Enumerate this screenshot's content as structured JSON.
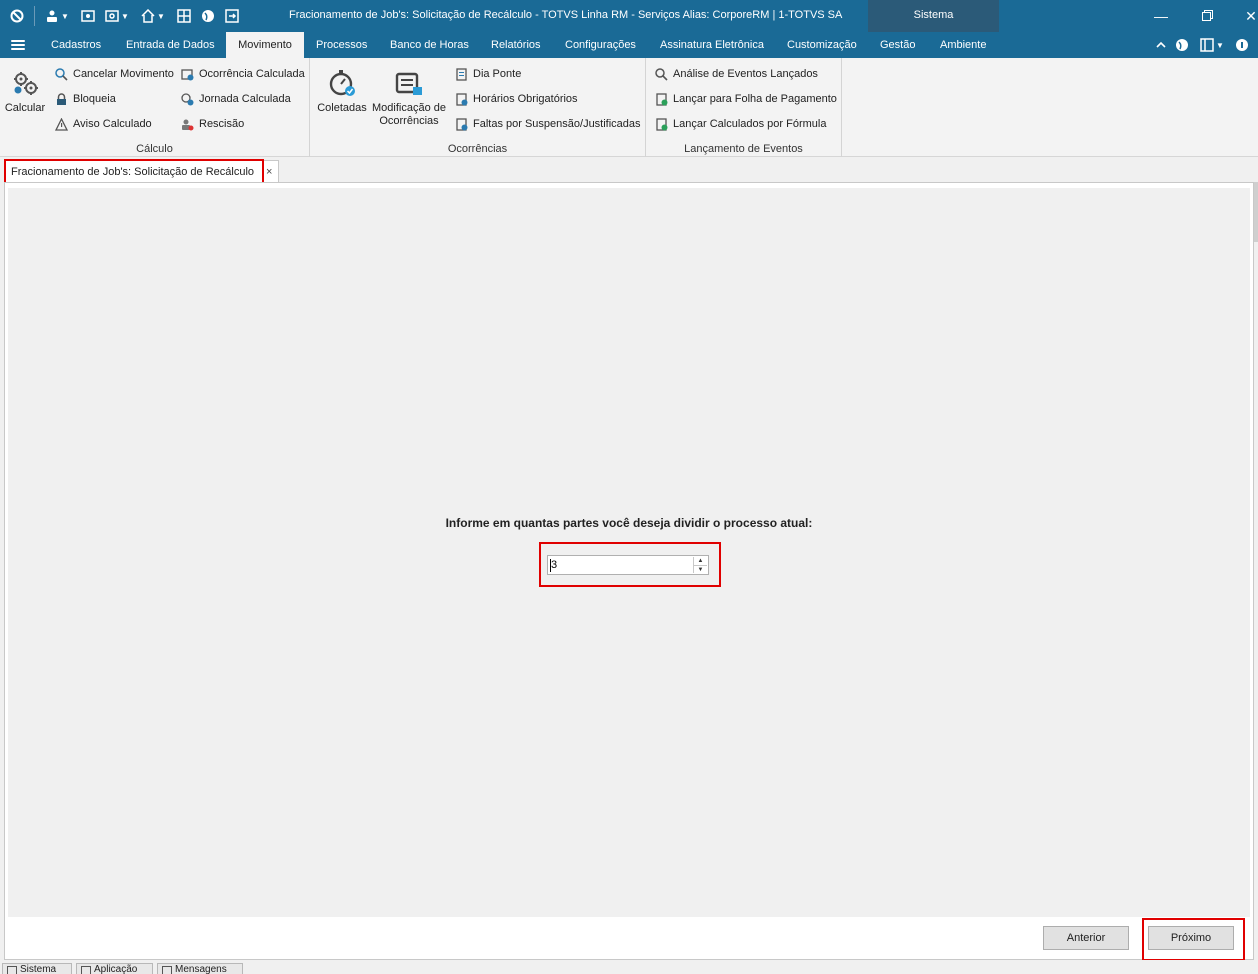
{
  "window": {
    "title": "Fracionamento de Job's: Solicitação de Recálculo - TOTVS Linha RM - Serviços  Alias: CorporeRM | 1-TOTVS SA",
    "sistema_label": "Sistema"
  },
  "menubar": {
    "items": [
      "Cadastros",
      "Entrada de Dados",
      "Movimento",
      "Processos",
      "Banco de Horas",
      "Relatórios",
      "Configurações",
      "Assinatura Eletrônica",
      "Customização",
      "Gestão",
      "Ambiente"
    ],
    "active": "Movimento"
  },
  "ribbon": {
    "calculo": {
      "label": "Cálculo",
      "calcular": "Calcular",
      "col1": [
        "Cancelar Movimento",
        "Bloqueia",
        "Aviso Calculado"
      ],
      "col2": [
        "Ocorrência Calculada",
        "Jornada Calculada",
        "Rescisão"
      ]
    },
    "ocorrencias": {
      "label": "Ocorrências",
      "coletadas": "Coletadas",
      "modificacao_line1": "Modificação de",
      "modificacao_line2": "Ocorrências",
      "items": [
        "Dia Ponte",
        "Horários Obrigatórios",
        "Faltas por Suspensão/Justificadas"
      ]
    },
    "lancamento": {
      "label": "Lançamento de Eventos",
      "items": [
        "Análise de Eventos Lançados",
        "Lançar para Folha de Pagamento",
        "Lançar Calculados por Fórmula"
      ]
    }
  },
  "document_tab": {
    "label": "Fracionamento de Job's: Solicitação de Recálculo",
    "close": "×"
  },
  "form": {
    "prompt": "Informe em quantas partes você deseja dividir o processo atual:",
    "parts_value": "3"
  },
  "buttons": {
    "anterior": "Anterior",
    "proximo": "Próximo"
  },
  "statusbar": {
    "tabs": [
      "Sistema",
      "Aplicação",
      "Mensagens"
    ]
  },
  "colors": {
    "titlebar": "#1a6a96",
    "highlight": "#e00000"
  }
}
